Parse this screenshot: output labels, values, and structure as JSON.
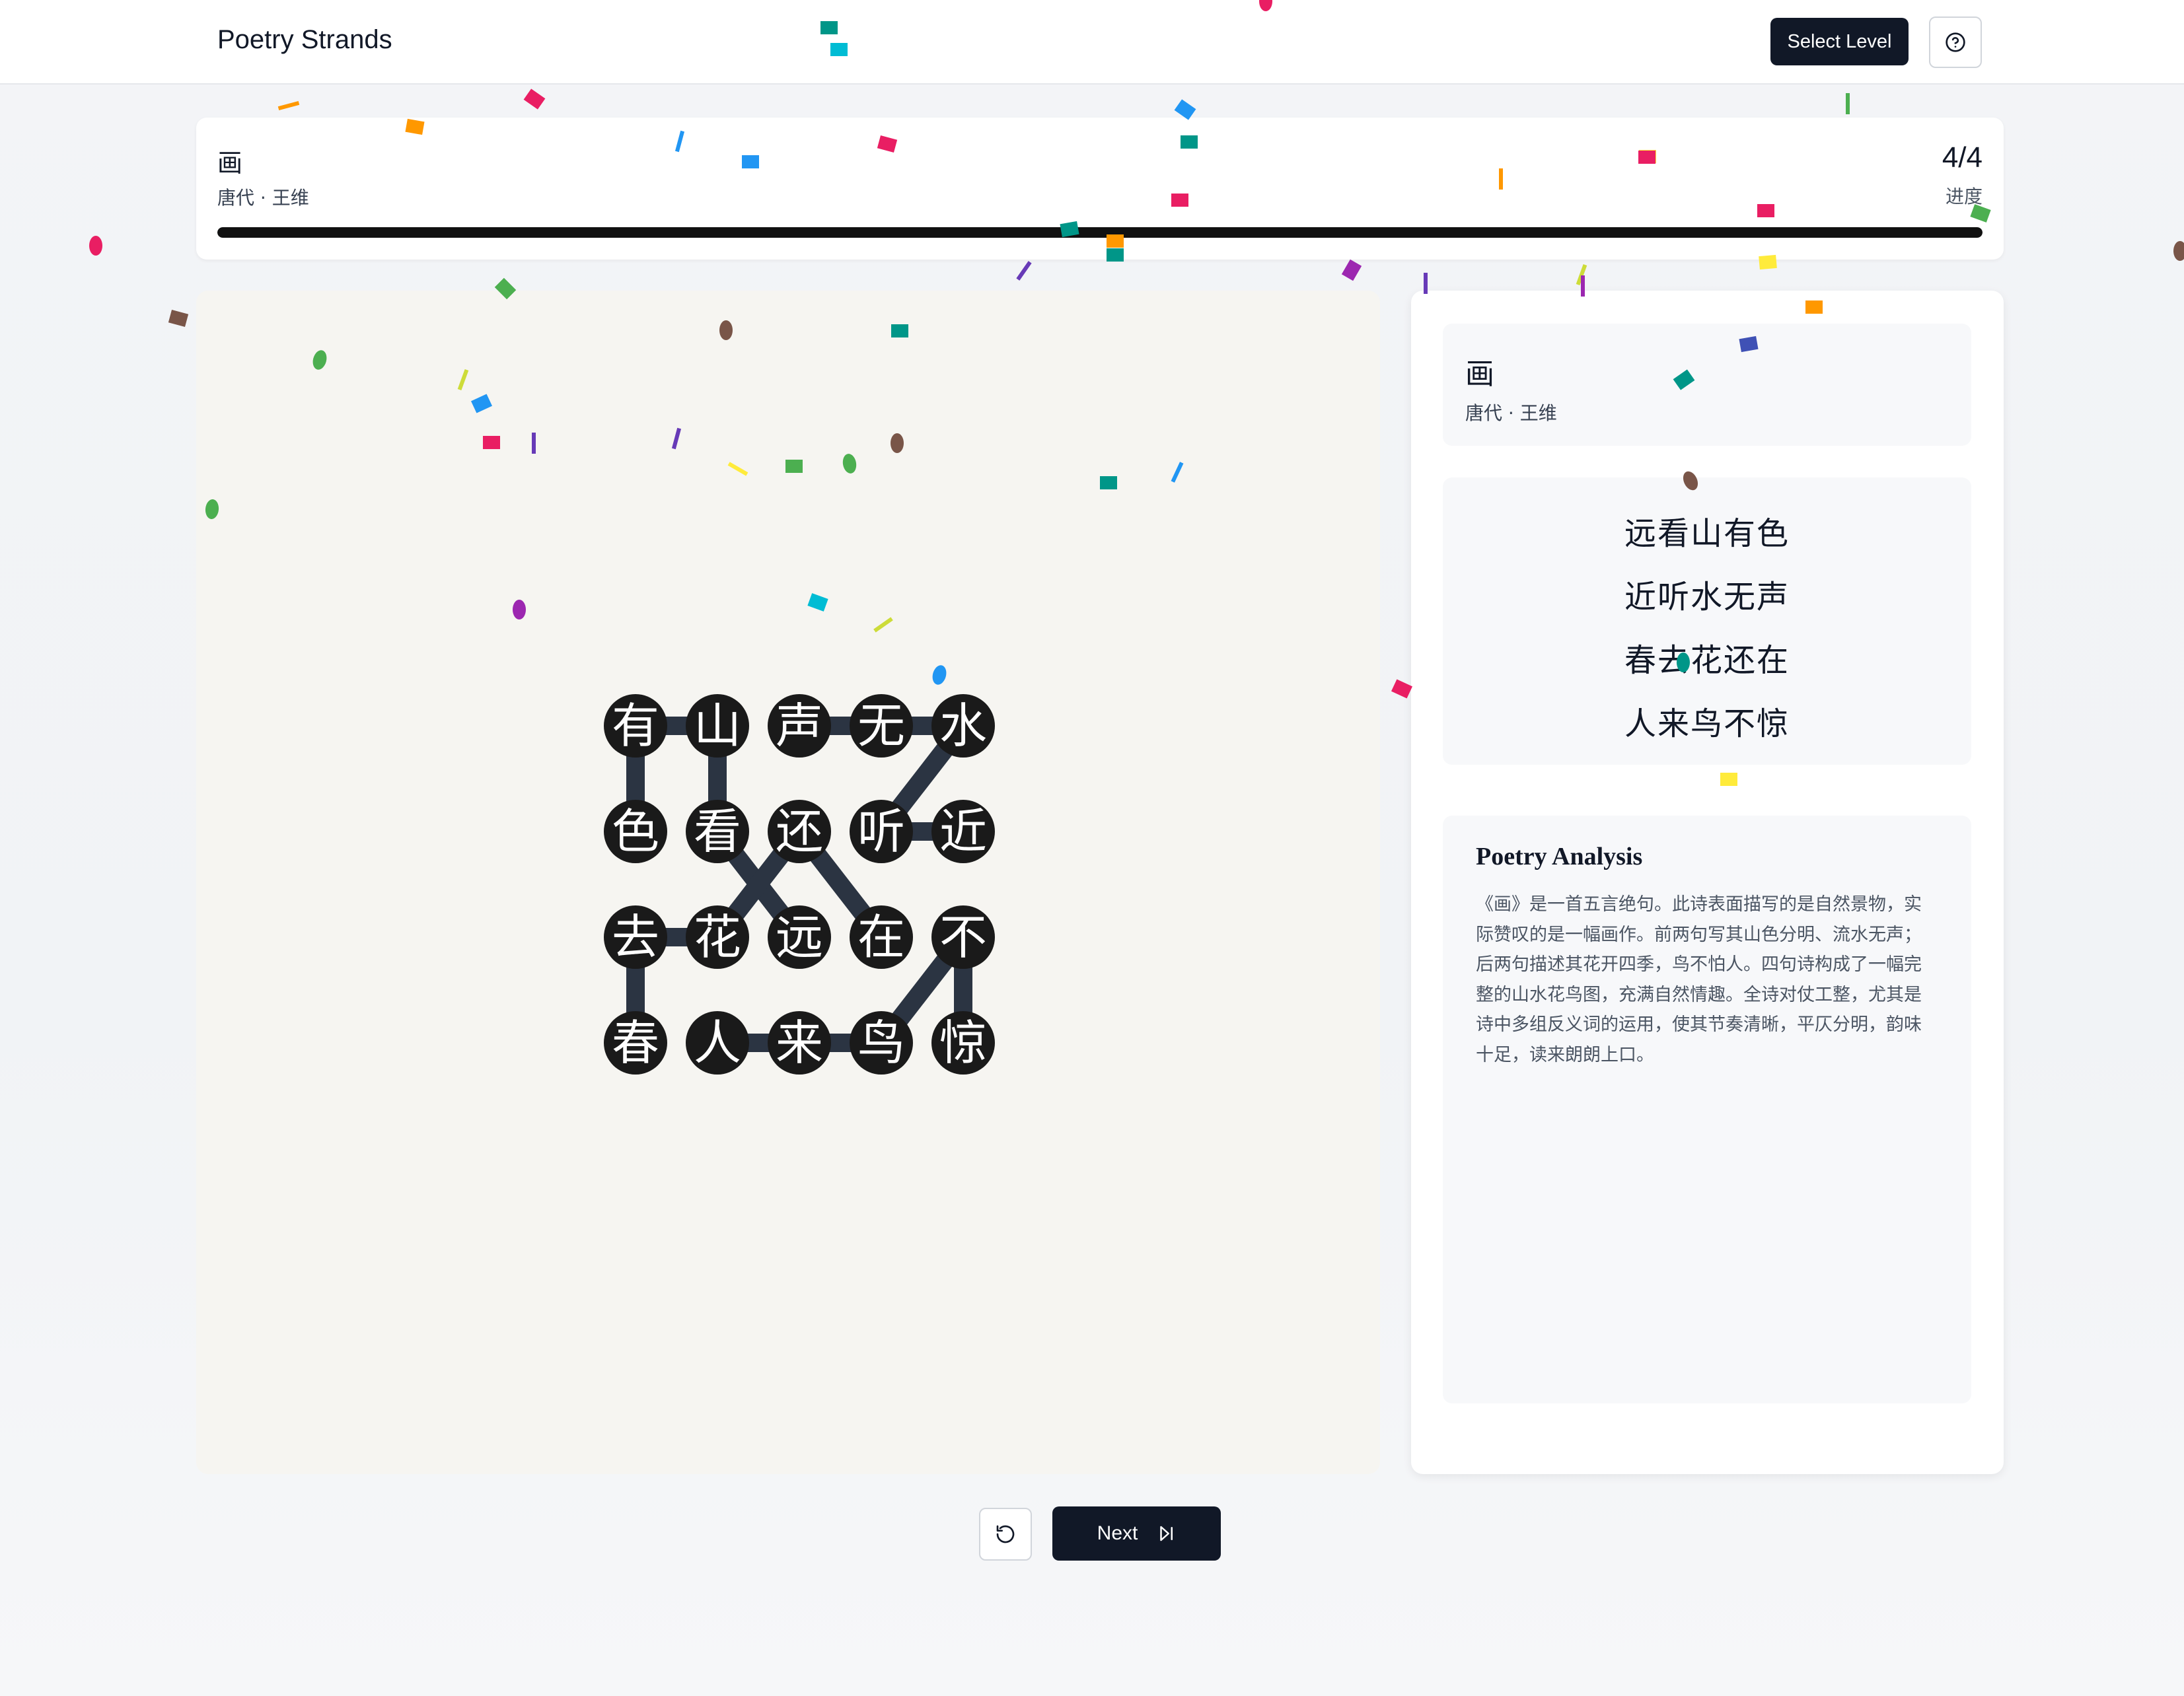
{
  "header": {
    "app_title": "Poetry Strands",
    "select_level_label": "Select Level",
    "help_icon": "question-circle-icon"
  },
  "progress": {
    "poem_title": "画",
    "meta": "唐代 · 王维",
    "count": "4/4",
    "label": "进度",
    "value": 1.0
  },
  "board": {
    "letters": [
      [
        "有",
        "山",
        "声",
        "无",
        "水"
      ],
      [
        "色",
        "看",
        "还",
        "听",
        "近"
      ],
      [
        "去",
        "花",
        "远",
        "在",
        "不"
      ],
      [
        "春",
        "人",
        "来",
        "鸟",
        "惊"
      ]
    ],
    "strands": [
      [
        "远",
        "看",
        "山",
        "有",
        "色"
      ],
      [
        "近",
        "听",
        "水",
        "无",
        "声"
      ],
      [
        "春",
        "去",
        "花",
        "还",
        "在"
      ],
      [
        "人",
        "来",
        "鸟",
        "不",
        "惊"
      ]
    ],
    "colors": {
      "tile": "#1a1a1a",
      "link": "#2b3442",
      "tile_text": "#ffffff"
    }
  },
  "panel": {
    "title": "画",
    "meta": "唐代 · 王维",
    "poem_lines": [
      "远看山有色",
      "近听水无声",
      "春去花还在",
      "人来鸟不惊"
    ],
    "analysis_title": "Poetry Analysis",
    "analysis_text": "《画》是一首五言绝句。此诗表面描写的是自然景物，实际赞叹的是一幅画作。前两句写其山色分明、流水无声；后两句描述其花开四季，鸟不怕人。四句诗构成了一幅完整的山水花鸟图，充满自然情趣。全诗对仗工整，尤其是诗中多组反义词的运用，使其节奏清晰，平仄分明，韵味十足，读来朗朗上口。"
  },
  "controls": {
    "reset_icon": "rotate-ccw-icon",
    "next_label": "Next",
    "next_icon": "skip-forward-icon"
  },
  "decor": {
    "confetti_colors": [
      "#e91e63",
      "#2196f3",
      "#4caf50",
      "#ff9800",
      "#9c27b0",
      "#00bcd4",
      "#ffeb3b",
      "#795548",
      "#3f51b5",
      "#009688",
      "#cddc39",
      "#673ab7"
    ]
  }
}
